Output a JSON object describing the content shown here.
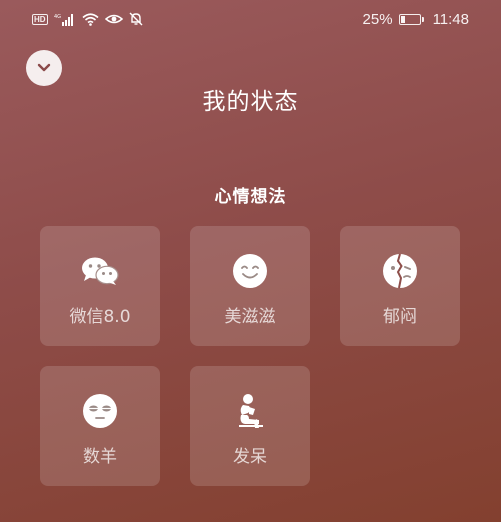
{
  "status_bar": {
    "hd_badge": "HD",
    "network": "4G",
    "battery_percent_label": "25%",
    "battery_level": 0.25,
    "time": "11:48"
  },
  "header": {
    "collapse_icon": "chevron-down-icon",
    "title": "我的状态"
  },
  "section": {
    "title": "心情想法",
    "items": [
      {
        "label": "微信8.0",
        "icon": "wechat-icon"
      },
      {
        "label": "美滋滋",
        "icon": "smile-icon"
      },
      {
        "label": "郁闷",
        "icon": "gloomy-face-icon"
      },
      {
        "label": "数羊",
        "icon": "sleepy-face-icon"
      },
      {
        "label": "发呆",
        "icon": "thinker-icon"
      }
    ]
  }
}
